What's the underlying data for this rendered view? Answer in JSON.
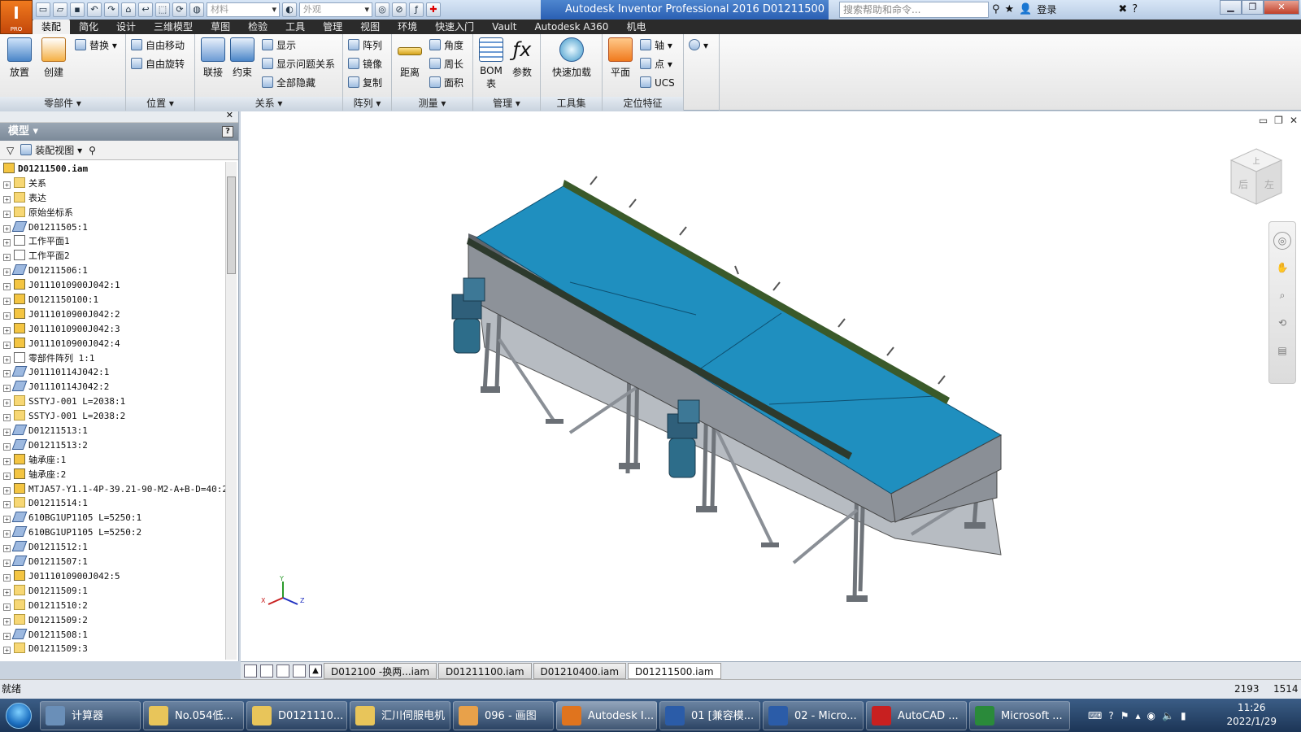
{
  "title_bar": {
    "app_logo": "I",
    "app_logo_sub": "PRO",
    "material_placeholder": "材料",
    "appearance_placeholder": "外观",
    "window_title": "Autodesk Inventor Professional 2016    D01211500",
    "help_search_placeholder": "搜索帮助和命令...",
    "login_label": "登录"
  },
  "menu_tabs": [
    "装配",
    "简化",
    "设计",
    "三维模型",
    "草图",
    "检验",
    "工具",
    "管理",
    "视图",
    "环境",
    "快速入门",
    "Vault",
    "Autodesk A360",
    "机电"
  ],
  "active_tab": "装配",
  "ribbon": {
    "parts_panel": {
      "label": "零部件 ▾",
      "place": "放置",
      "create": "创建",
      "replace": "替换"
    },
    "position_panel": {
      "label": "位置 ▾",
      "free_move": "自由移动",
      "free_rotate": "自由旋转"
    },
    "relations_panel": {
      "label": "关系 ▾",
      "join": "联接",
      "constrain": "约束",
      "show": "显示",
      "show_problem": "显示问题关系",
      "hide_all": "全部隐藏"
    },
    "pattern_panel": {
      "label": "阵列 ▾",
      "pattern": "阵列",
      "mirror": "镜像",
      "copy": "复制"
    },
    "measure_panel": {
      "label": "测量 ▾",
      "distance": "距离",
      "angle": "角度",
      "loop": "周长",
      "area": "面积"
    },
    "manage_panel": {
      "label": "管理 ▾",
      "bom": "BOM 表",
      "params": "参数"
    },
    "tools_panel": {
      "label": "工具集",
      "quick_load": "快速加载"
    },
    "work_features_panel": {
      "label": "定位特征",
      "plane": "平面",
      "axis": "轴",
      "point": "点",
      "ucs": "UCS"
    }
  },
  "browser": {
    "title": "模型 ▾",
    "view_label": "装配视图",
    "root": "D01211500.iam",
    "nodes": [
      {
        "label": "关系",
        "icon": "folder"
      },
      {
        "label": "表达",
        "icon": "folder"
      },
      {
        "label": "原始坐标系",
        "icon": "folder"
      },
      {
        "label": "D01211505:1",
        "icon": "part"
      },
      {
        "label": "工作平面1",
        "icon": "plane"
      },
      {
        "label": "工作平面2",
        "icon": "plane"
      },
      {
        "label": "D01211506:1",
        "icon": "part"
      },
      {
        "label": "J0111010900J042:1",
        "icon": "assembly"
      },
      {
        "label": "D0121150100:1",
        "icon": "assembly"
      },
      {
        "label": "J0111010900J042:2",
        "icon": "assembly"
      },
      {
        "label": "J0111010900J042:3",
        "icon": "assembly"
      },
      {
        "label": "J0111010900J042:4",
        "icon": "assembly"
      },
      {
        "label": "零部件阵列 1:1",
        "icon": "pattern"
      },
      {
        "label": "J01110114J042:1",
        "icon": "part"
      },
      {
        "label": "J01110114J042:2",
        "icon": "part"
      },
      {
        "label": "SSTYJ-001 L=2038:1",
        "icon": "folder"
      },
      {
        "label": "SSTYJ-001 L=2038:2",
        "icon": "folder"
      },
      {
        "label": "D01211513:1",
        "icon": "part"
      },
      {
        "label": "D01211513:2",
        "icon": "part"
      },
      {
        "label": "轴承座:1",
        "icon": "assembly"
      },
      {
        "label": "轴承座:2",
        "icon": "assembly"
      },
      {
        "label": "MTJA57-Y1.1-4P-39.21-90-M2-A+B-D=40:2",
        "icon": "assembly"
      },
      {
        "label": "D01211514:1",
        "icon": "folder"
      },
      {
        "label": "610BG1UP1105 L=5250:1",
        "icon": "part"
      },
      {
        "label": "610BG1UP1105 L=5250:2",
        "icon": "part"
      },
      {
        "label": "D01211512:1",
        "icon": "part"
      },
      {
        "label": "D01211507:1",
        "icon": "part"
      },
      {
        "label": "J0111010900J042:5",
        "icon": "assembly"
      },
      {
        "label": "D01211509:1",
        "icon": "folder"
      },
      {
        "label": "D01211510:2",
        "icon": "folder"
      },
      {
        "label": "D01211509:2",
        "icon": "folder"
      },
      {
        "label": "D01211508:1",
        "icon": "part"
      },
      {
        "label": "D01211509:3",
        "icon": "folder"
      }
    ]
  },
  "viewcube": {
    "top": "上",
    "front": "后",
    "right": "左"
  },
  "triad": {
    "x": "X",
    "y": "Y",
    "z": "Z"
  },
  "doc_tabs": [
    "D012100 -换两...iam",
    "D01211100.iam",
    "D01210400.iam",
    "D01211500.iam"
  ],
  "active_doc": "D01211500.iam",
  "status": {
    "message": "就绪",
    "count1": "2193",
    "count2": "1514"
  },
  "taskbar": {
    "items": [
      {
        "label": "计算器",
        "color": "#6a8fb8"
      },
      {
        "label": "No.054低...",
        "color": "#e8c55a"
      },
      {
        "label": "D0121110...",
        "color": "#e8c55a"
      },
      {
        "label": "汇川伺服电机",
        "color": "#e8c55a"
      },
      {
        "label": "096 - 画图",
        "color": "#e8a14a"
      },
      {
        "label": "Autodesk I...",
        "color": "#e0741e"
      },
      {
        "label": "01 [兼容模...",
        "color": "#2b5ca8"
      },
      {
        "label": "02 - Micro...",
        "color": "#2b5ca8"
      },
      {
        "label": "AutoCAD ...",
        "color": "#c82020"
      },
      {
        "label": "Microsoft ...",
        "color": "#2a8a3a"
      }
    ],
    "active_index": 5,
    "time": "11:26",
    "date": "2022/1/29"
  },
  "colors": {
    "belt": "#1f8fbf",
    "frame": "#8a8f96",
    "motor": "#2f5f7a",
    "guide": "#3a5a2a"
  }
}
